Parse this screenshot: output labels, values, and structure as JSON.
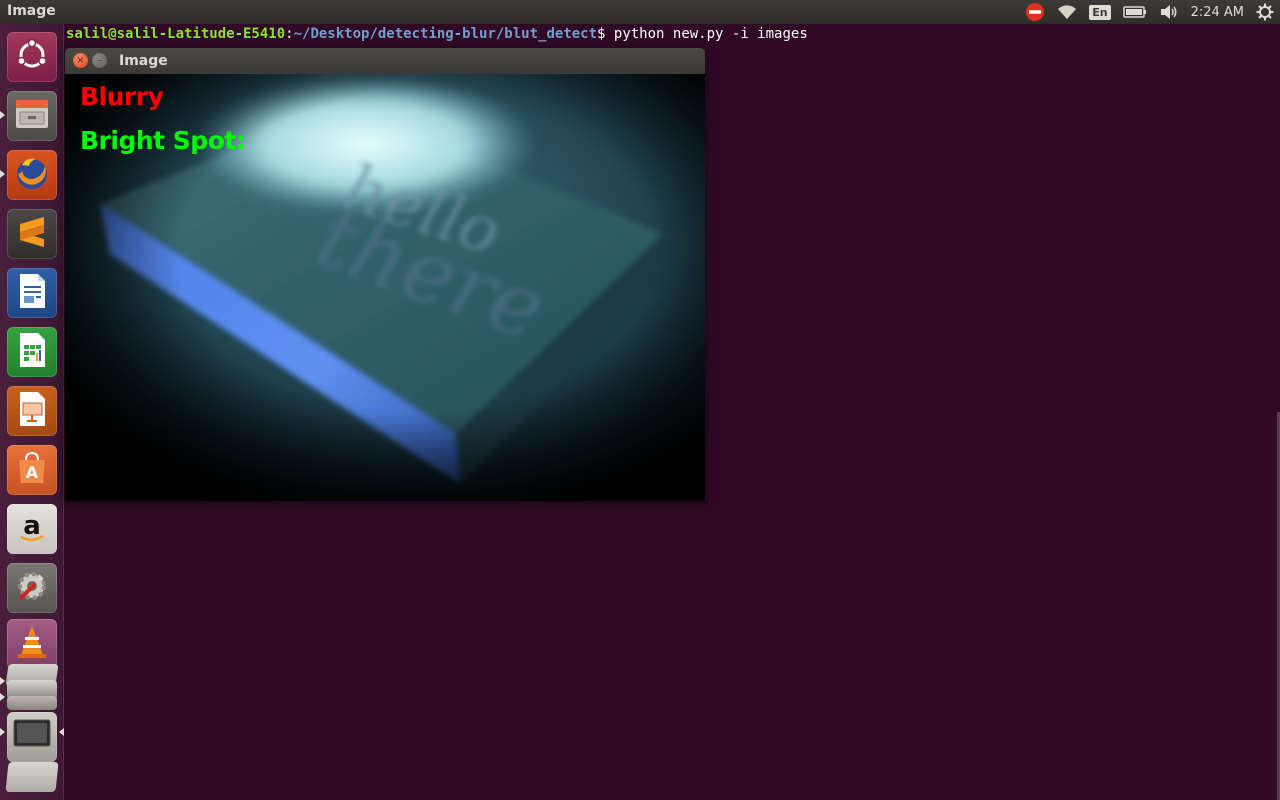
{
  "top_panel": {
    "app_title": "Image",
    "keyboard_layout": "En",
    "clock": "2:24 AM",
    "indicators": [
      "no-entry-icon",
      "wifi-icon",
      "keyboard-icon",
      "battery-icon",
      "volume-icon",
      "power-gear-icon"
    ]
  },
  "launcher": {
    "items": [
      {
        "name": "ubuntu-dash",
        "icon": "ubuntu-logo-icon"
      },
      {
        "name": "files",
        "icon": "file-cabinet-icon"
      },
      {
        "name": "firefox",
        "icon": "firefox-icon"
      },
      {
        "name": "sublime-text",
        "icon": "sublime-icon"
      },
      {
        "name": "libreoffice-writer",
        "icon": "writer-icon"
      },
      {
        "name": "libreoffice-calc",
        "icon": "calc-icon"
      },
      {
        "name": "libreoffice-impress",
        "icon": "impress-icon"
      },
      {
        "name": "ubuntu-software",
        "icon": "software-center-icon"
      },
      {
        "name": "amazon",
        "icon": "amazon-icon"
      },
      {
        "name": "system-settings",
        "icon": "settings-wrench-icon"
      },
      {
        "name": "vlc",
        "icon": "vlc-cone-icon"
      }
    ]
  },
  "terminal": {
    "user_host": "salil@salil-Latitude-E5410",
    "colon": ":",
    "path": "~/Desktop/detecting-blur/blut_detect",
    "prompt": "$",
    "command": " python new.py -i images"
  },
  "image_window": {
    "title": "Image",
    "close_glyph": "×",
    "minimize_glyph": "–",
    "labels": {
      "blur_status": "Blurry",
      "bright_spot": "Bright Spot:"
    },
    "photo_text": {
      "line1": "hello",
      "line2": "there"
    }
  },
  "colors": {
    "desktop_bg": "#300a24",
    "blurry_label": "#ff0000",
    "bright_spot_label": "#00ff00",
    "prompt_user": "#8ae234",
    "prompt_path": "#729fcf"
  }
}
